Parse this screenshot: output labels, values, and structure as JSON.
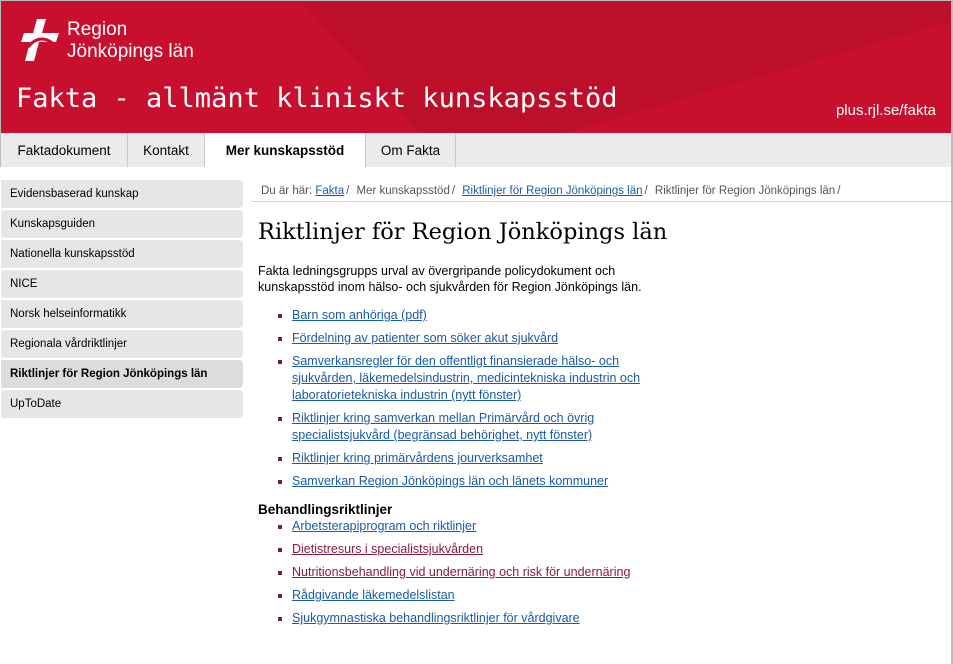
{
  "header": {
    "logo_line1": "Region",
    "logo_line2": "Jönköpings län",
    "title": "Fakta - allmänt kliniskt kunskapsstöd",
    "url": "plus.rjl.se/fakta",
    "colors": {
      "brand_red": "#c8102e",
      "dark_red": "#a50d26"
    }
  },
  "tabs": [
    {
      "label": "Faktadokument"
    },
    {
      "label": "Kontakt"
    },
    {
      "label": "Mer kunskapsstöd",
      "active": true
    },
    {
      "label": "Om Fakta"
    }
  ],
  "sidebar": {
    "items": [
      {
        "label": "Evidensbaserad kunskap"
      },
      {
        "label": "Kunskapsguiden"
      },
      {
        "label": "Nationella kunskapsstöd"
      },
      {
        "label": "NICE"
      },
      {
        "label": "Norsk helseinformatikk"
      },
      {
        "label": "Regionala vårdriktlinjer"
      },
      {
        "label": "Riktlinjer för Region Jönköpings län",
        "active": true
      },
      {
        "label": "UpToDate"
      }
    ]
  },
  "breadcrumb": {
    "prefix": "Du är här:",
    "items": [
      "Fakta",
      "Mer kunskapsstöd",
      "Riktlinjer för Region Jönköpings län",
      "Riktlinjer för Region Jönköpings län"
    ],
    "sep": "/"
  },
  "main": {
    "title": "Riktlinjer för Region Jönköpings län",
    "intro": "Fakta ledningsgrupps urval av övergripande policydokument och kunskapsstöd inom hälso- och sjukvården för Region Jönköpings län.",
    "links": [
      "Barn som anhöriga (pdf)",
      "Fördelning av patienter som söker akut sjukvård",
      "Samverkansregler för den offentligt finansierade hälso- och sjukvården, läkemedelsindustrin, medicintekniska industrin och laboratorietekniska industrin (nytt fönster)",
      "Riktlinjer kring samverkan mellan Primärvård och övrig specialistsjukvård (begränsad behörighet, nytt fönster)",
      "Riktlinjer kring primärvårdens jourverksamhet",
      "Samverkan Region Jönköpings län och länets kommuner"
    ],
    "section_heading": "Behandlingsriktlinjer",
    "treatment_links": [
      "Arbetsterapiprogram och riktlinjer",
      "Dietistresurs i specialistsjukvården",
      "Nutritionsbehandling vid undernäring och risk för undernäring",
      "Rådgivande läkemedelslistan",
      "Sjukgymnastiska behandlingsriktlinjer för vårdgivare"
    ]
  }
}
